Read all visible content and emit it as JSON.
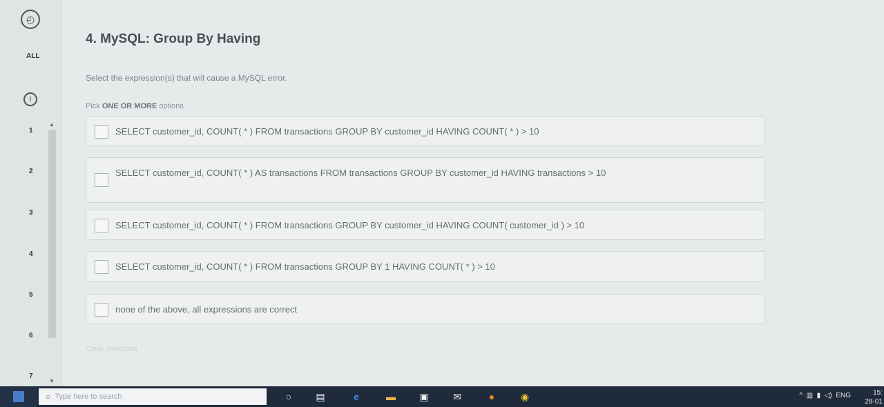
{
  "rail": {
    "all_label": "ALL",
    "numbers": [
      "1",
      "2",
      "3",
      "4",
      "5",
      "6",
      "7"
    ]
  },
  "question": {
    "title": "4. MySQL: Group By Having",
    "instruction": "Select the expression(s) that will cause a MySQL error.",
    "pick_prefix": "Pick ",
    "pick_bold": "ONE OR MORE",
    "pick_suffix": " options",
    "options": [
      "SELECT customer_id, COUNT( * ) FROM transactions GROUP BY customer_id HAVING COUNT( * ) > 10",
      "SELECT customer_id, COUNT( * ) AS transactions FROM transactions GROUP BY customer_id HAVING transactions > 10",
      "SELECT customer_id, COUNT( * ) FROM transactions GROUP BY customer_id HAVING COUNT( customer_id ) > 10",
      "SELECT customer_id, COUNT( * ) FROM transactions GROUP BY 1 HAVING COUNT( * ) > 10",
      "none of the above, all expressions are correct"
    ],
    "clear_label": "Clear Selection"
  },
  "taskbar": {
    "search_placeholder": "Type here to search",
    "language": "ENG",
    "time": "15:",
    "date": "28-01"
  }
}
